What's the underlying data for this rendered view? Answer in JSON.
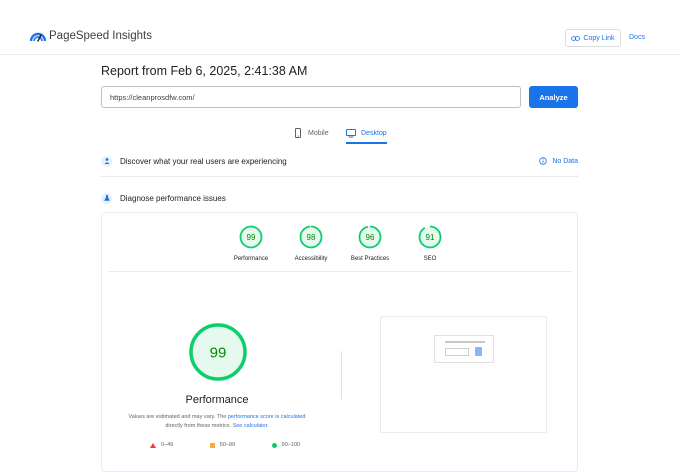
{
  "header": {
    "brand": "PageSpeed Insights",
    "copy_link_label": "Copy Link",
    "docs_label": "Docs"
  },
  "report": {
    "title": "Report from Feb 6, 2025, 2:41:38 AM",
    "url_value": "https://cleanprosdfw.com/",
    "analyze_label": "Analyze"
  },
  "tabs": [
    {
      "label": "Mobile",
      "icon": "phone-icon",
      "selected": false
    },
    {
      "label": "Desktop",
      "icon": "monitor-icon",
      "selected": true
    }
  ],
  "field_data": {
    "heading": "Discover what your real users are experiencing",
    "status": "No Data"
  },
  "diagnose": {
    "heading": "Diagnose performance issues"
  },
  "scores": [
    {
      "label": "Performance",
      "value": "99"
    },
    {
      "label": "Accessibility",
      "value": "98"
    },
    {
      "label": "Best Practices",
      "value": "96"
    },
    {
      "label": "SEO",
      "value": "91"
    }
  ],
  "performance": {
    "score": "99",
    "title": "Performance",
    "disclaimer_prefix": "Values are estimated and may vary. The",
    "disclaimer_link1": "performance score is calculated",
    "disclaimer_mid": "directly from these metrics.",
    "disclaimer_link2": "See calculator."
  },
  "legend": [
    {
      "label": "0–49",
      "color": "#ff3333"
    },
    {
      "label": "50–89",
      "color": "#ffaa33"
    },
    {
      "label": "90–100",
      "color": "#0cce6b"
    }
  ],
  "colors": {
    "accent": "#1a73e8",
    "pass": "#0cce6b",
    "pass_text": "#008800",
    "pass_fill": "#e6f9ee"
  }
}
